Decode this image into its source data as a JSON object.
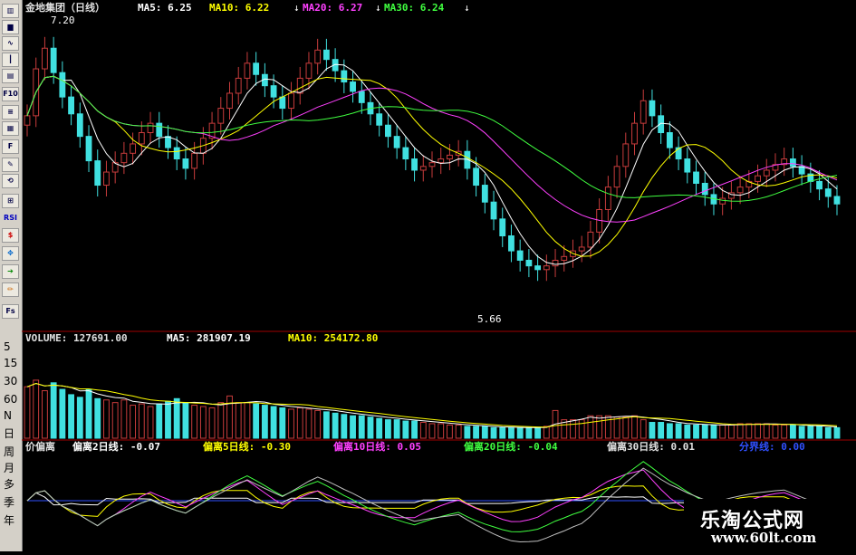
{
  "toolbar": {
    "icons": [
      "k-line-icon",
      "bar-chart-icon",
      "line-chart-icon",
      "candle-icon",
      "tick-icon",
      "f10-icon",
      "notes-icon",
      "report-icon",
      "f12-icon",
      "drawing-icon",
      "history-icon",
      "indicator-icon",
      "rsi-icon",
      "warning-icon",
      "move-icon",
      "export-icon",
      "pencil-icon",
      "fs-icon"
    ],
    "btn_f10": "F10",
    "btn_rsi": "RSI",
    "btn_fs": "Fs",
    "periods": [
      "5",
      "15",
      "30",
      "60",
      "N",
      "日",
      "周",
      "月",
      "多",
      "季",
      "年"
    ]
  },
  "price_header": {
    "stock": "金地集团（日线）",
    "ma5": "MA5: 6.25",
    "ma10": "MA10: 6.22",
    "ma20": "MA20: 6.27",
    "ma30": "MA30: 6.24",
    "high_label": "7.20",
    "low_label": "5.66"
  },
  "volume_header": {
    "volume": "VOLUME: 127691.00",
    "ma5": "MA5: 281907.19",
    "ma10": "MA10: 254172.80"
  },
  "indicator_header": {
    "name": "价偏离",
    "b2": "偏离2日线: -0.07",
    "b5": "偏离5日线: -0.30",
    "b10": "偏离10日线: 0.05",
    "b20": "偏离20日线: -0.04",
    "b30": "偏离30日线: 0.01",
    "line": "分界线: 0.00"
  },
  "colors": {
    "up": "#c83c3c",
    "down": "#40e0e0",
    "ma5": "#ffffff",
    "ma10": "#ffff00",
    "ma20": "#ff40ff",
    "ma30": "#40ff40",
    "grid": "#800000",
    "divider": "#a00000"
  },
  "watermark": {
    "title": "乐淘公式网",
    "url": "www.60lt.com"
  },
  "chart_data": [
    {
      "type": "candlestick",
      "title": "金地集团（日线）",
      "ylim": [
        5.6,
        7.25
      ],
      "annotations": [
        {
          "label": "7.20",
          "y": 7.2
        },
        {
          "label": "5.66",
          "y": 5.66
        }
      ],
      "close": [
        6.72,
        6.97,
        7.08,
        6.95,
        6.82,
        6.73,
        6.61,
        6.48,
        6.35,
        6.42,
        6.47,
        6.52,
        6.57,
        6.63,
        6.68,
        6.61,
        6.55,
        6.49,
        6.44,
        6.52,
        6.6,
        6.68,
        6.76,
        6.84,
        6.92,
        7.0,
        6.94,
        6.88,
        6.82,
        6.76,
        6.84,
        6.92,
        7.0,
        7.07,
        7.02,
        6.96,
        6.9,
        6.85,
        6.79,
        6.73,
        6.67,
        6.61,
        6.55,
        6.49,
        6.43,
        6.45,
        6.47,
        6.49,
        6.51,
        6.53,
        6.44,
        6.35,
        6.26,
        6.17,
        6.08,
        6.0,
        5.95,
        5.92,
        5.9,
        5.92,
        5.95,
        5.97,
        6.0,
        6.02,
        6.1,
        6.22,
        6.34,
        6.45,
        6.57,
        6.68,
        6.8,
        6.72,
        6.63,
        6.55,
        6.49,
        6.42,
        6.36,
        6.3,
        6.25,
        6.28,
        6.31,
        6.34,
        6.37,
        6.4,
        6.43,
        6.46,
        6.49,
        6.45,
        6.41,
        6.37,
        6.33,
        6.29,
        6.25
      ],
      "series": [
        {
          "name": "MA5",
          "last": 6.25
        },
        {
          "name": "MA10",
          "last": 6.22
        },
        {
          "name": "MA20",
          "last": 6.27
        },
        {
          "name": "MA30",
          "last": 6.24
        }
      ]
    },
    {
      "type": "bar",
      "title": "VOLUME",
      "ylim": [
        0,
        700000
      ],
      "values": [
        390000,
        440000,
        360000,
        420000,
        370000,
        330000,
        310000,
        370000,
        300000,
        290000,
        270000,
        290000,
        250000,
        260000,
        240000,
        260000,
        280000,
        300000,
        270000,
        250000,
        240000,
        230000,
        270000,
        320000,
        270000,
        270000,
        260000,
        250000,
        240000,
        230000,
        220000,
        230000,
        220000,
        210000,
        200000,
        190000,
        180000,
        170000,
        170000,
        160000,
        150000,
        140000,
        140000,
        130000,
        130000,
        120000,
        110000,
        110000,
        100000,
        100000,
        90000,
        90000,
        90000,
        80000,
        80000,
        80000,
        80000,
        80000,
        80000,
        90000,
        210000,
        140000,
        140000,
        140000,
        170000,
        170000,
        170000,
        160000,
        160000,
        170000,
        140000,
        120000,
        120000,
        110000,
        110000,
        100000,
        100000,
        100000,
        100000,
        100000,
        100000,
        110000,
        110000,
        110000,
        110000,
        100000,
        100000,
        100000,
        90000,
        90000,
        90000,
        80000,
        80000
      ],
      "series": [
        {
          "name": "VOLUME",
          "last": 127691.0
        },
        {
          "name": "MA5",
          "last": 281907.19
        },
        {
          "name": "MA10",
          "last": 254172.8
        }
      ]
    },
    {
      "type": "line",
      "title": "价偏离",
      "series": [
        {
          "name": "偏离2日线",
          "last": -0.07
        },
        {
          "name": "偏离5日线",
          "last": -0.3
        },
        {
          "name": "偏离10日线",
          "last": 0.05
        },
        {
          "name": "偏离20日线",
          "last": -0.04
        },
        {
          "name": "偏离30日线",
          "last": 0.01
        },
        {
          "name": "分界线",
          "last": 0.0
        }
      ]
    }
  ]
}
